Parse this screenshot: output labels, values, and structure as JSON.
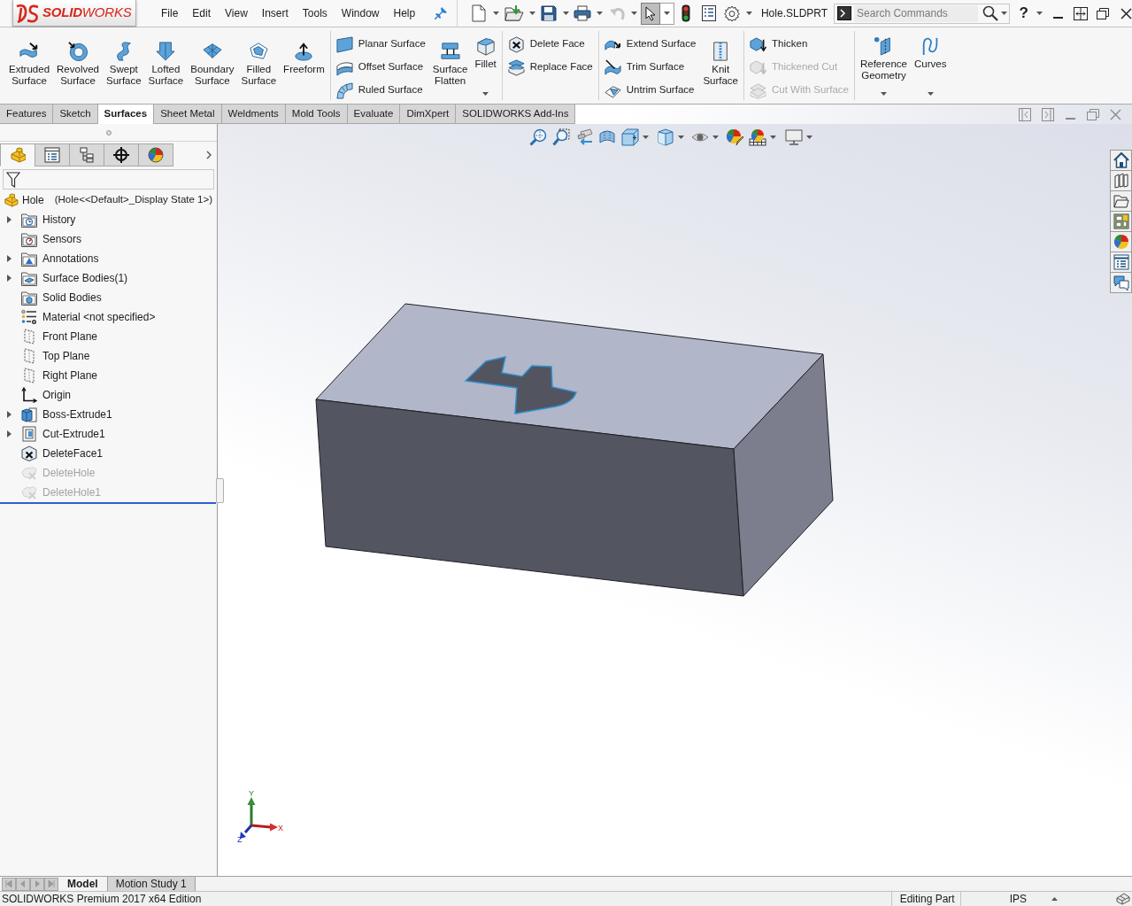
{
  "menu_bar": {
    "logo": "**SOLID**WORKS",
    "menus": [
      "File",
      "Edit",
      "View",
      "Insert",
      "Tools",
      "Window",
      "Help"
    ],
    "select_tool_active": true,
    "document_title": "Hole.SLDPRT",
    "search": {
      "placeholder": "Search Commands"
    },
    "help": "?"
  },
  "ribbon": {
    "groups": [
      {
        "blocks": [
          {
            "kind": "large",
            "label": "Extruded Surface",
            "dropdown": false
          },
          {
            "kind": "large",
            "label": "Revolved Surface",
            "dropdown": false
          },
          {
            "kind": "large",
            "label": "Swept Surface",
            "dropdown": false
          },
          {
            "kind": "large",
            "label": "Lofted Surface",
            "dropdown": false
          },
          {
            "kind": "large",
            "label": "Boundary Surface",
            "dropdown": false
          },
          {
            "kind": "large",
            "label": "Filled Surface",
            "dropdown": false
          },
          {
            "kind": "large",
            "label": "Freeform",
            "dropdown": false
          }
        ]
      },
      {
        "blocks": [
          {
            "kind": "stack",
            "items": [
              {
                "label": "Planar Surface",
                "disabled": false
              },
              {
                "label": "Offset Surface",
                "disabled": false
              },
              {
                "label": "Ruled Surface",
                "disabled": false
              }
            ]
          },
          {
            "kind": "large",
            "label": "Surface Flatten",
            "dropdown": false
          },
          {
            "kind": "large",
            "label": "Fillet",
            "dropdown": true
          }
        ]
      },
      {
        "blocks": [
          {
            "kind": "stack",
            "items": [
              {
                "label": "Delete Face",
                "disabled": false
              },
              {
                "label": "Replace Face",
                "disabled": false
              }
            ]
          }
        ]
      },
      {
        "blocks": [
          {
            "kind": "stack",
            "items": [
              {
                "label": "Extend Surface",
                "disabled": false
              },
              {
                "label": "Trim Surface",
                "disabled": false
              },
              {
                "label": "Untrim Surface",
                "disabled": false
              }
            ]
          },
          {
            "kind": "large",
            "label": "Knit Surface",
            "dropdown": false
          }
        ]
      },
      {
        "blocks": [
          {
            "kind": "stack",
            "items": [
              {
                "label": "Thicken",
                "disabled": false
              },
              {
                "label": "Thickened Cut",
                "disabled": true
              },
              {
                "label": "Cut With Surface",
                "disabled": true
              }
            ]
          }
        ]
      },
      {
        "blocks": [
          {
            "kind": "large",
            "label": "Reference Geometry",
            "dropdown": true
          },
          {
            "kind": "large",
            "label": "Curves",
            "dropdown": true
          }
        ]
      }
    ]
  },
  "command_tabs": [
    {
      "label": "Features",
      "selected": false
    },
    {
      "label": "Sketch",
      "selected": false
    },
    {
      "label": "Surfaces",
      "selected": true
    },
    {
      "label": "Sheet Metal",
      "selected": false
    },
    {
      "label": "Weldments",
      "selected": false
    },
    {
      "label": "Mold Tools",
      "selected": false
    },
    {
      "label": "Evaluate",
      "selected": false
    },
    {
      "label": "DimXpert",
      "selected": false
    },
    {
      "label": "SOLIDWORKS Add-Ins",
      "selected": false
    }
  ],
  "feature_manager": {
    "tabs": [
      {
        "selected": true
      },
      {
        "selected": false
      },
      {
        "selected": false
      },
      {
        "selected": false
      },
      {
        "selected": false
      }
    ],
    "root": {
      "name": "Hole",
      "configuration": "(Hole<<Default>_Display State 1>)"
    },
    "items": [
      {
        "label": "History",
        "expandable": true,
        "suppressed": false
      },
      {
        "label": "Sensors",
        "expandable": false,
        "suppressed": false
      },
      {
        "label": "Annotations",
        "expandable": true,
        "suppressed": false
      },
      {
        "label": "Surface Bodies(1)",
        "expandable": true,
        "suppressed": false
      },
      {
        "label": "Solid Bodies",
        "expandable": false,
        "suppressed": false
      },
      {
        "label": "Material <not specified>",
        "expandable": false,
        "suppressed": false
      },
      {
        "label": "Front Plane",
        "expandable": false,
        "suppressed": false
      },
      {
        "label": "Top Plane",
        "expandable": false,
        "suppressed": false
      },
      {
        "label": "Right Plane",
        "expandable": false,
        "suppressed": false
      },
      {
        "label": "Origin",
        "expandable": false,
        "suppressed": false
      },
      {
        "label": "Boss-Extrude1",
        "expandable": true,
        "suppressed": false
      },
      {
        "label": "Cut-Extrude1",
        "expandable": true,
        "suppressed": false
      },
      {
        "label": "DeleteFace1",
        "expandable": false,
        "suppressed": false
      },
      {
        "label": "DeleteHole",
        "expandable": false,
        "suppressed": true
      },
      {
        "label": "DeleteHole1",
        "expandable": false,
        "suppressed": true
      }
    ]
  },
  "viewport": {
    "triad": {
      "x": "X",
      "y": "Y",
      "z": "Z"
    }
  },
  "bottom_tabs": [
    {
      "label": "Model",
      "selected": true
    },
    {
      "label": "Motion Study 1",
      "selected": false
    }
  ],
  "status_bar": {
    "edition": "SOLIDWORKS Premium 2017 x64 Edition",
    "mode": "Editing Part",
    "units": "IPS"
  }
}
